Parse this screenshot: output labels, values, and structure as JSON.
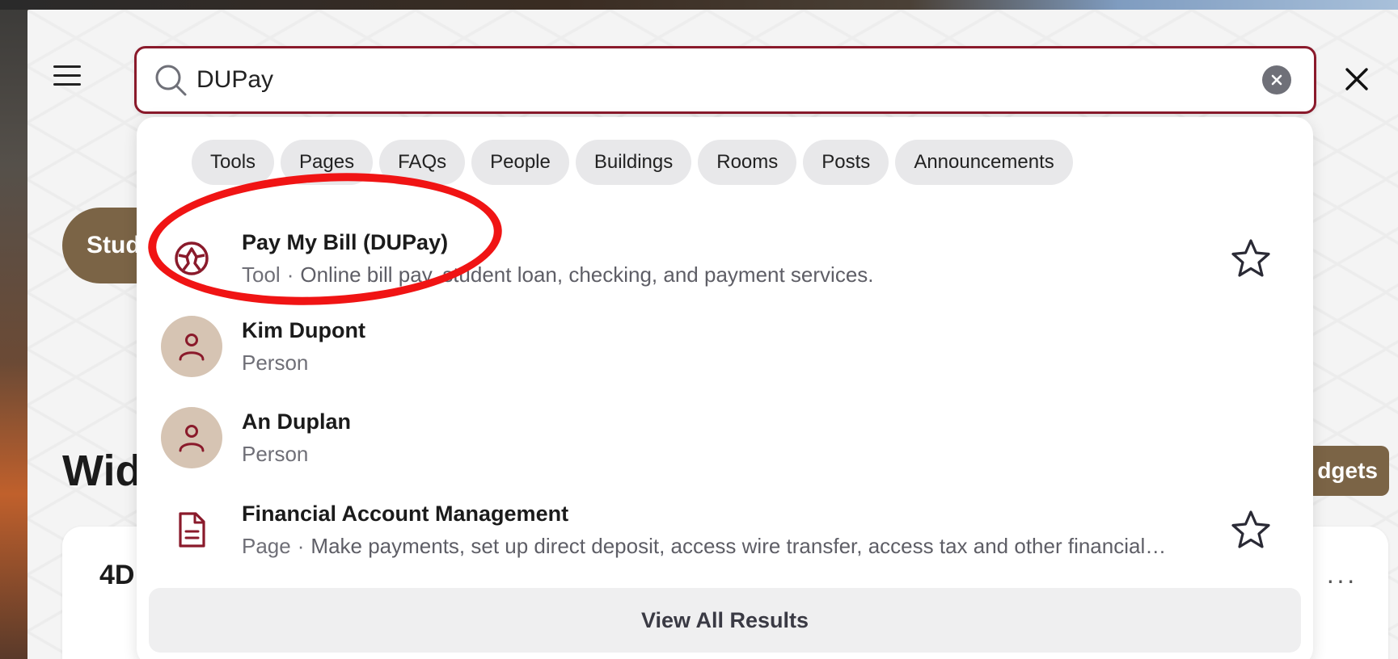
{
  "search": {
    "value": "DUPay",
    "placeholder": ""
  },
  "background_page": {
    "student_pill_label": "Stud",
    "widgets_title": "Wid",
    "widgets_button_label": "dgets",
    "card_title": "4D",
    "card_more": "···"
  },
  "filters": [
    {
      "label": "Tools"
    },
    {
      "label": "Pages"
    },
    {
      "label": "FAQs"
    },
    {
      "label": "People"
    },
    {
      "label": "Buildings"
    },
    {
      "label": "Rooms"
    },
    {
      "label": "Posts"
    },
    {
      "label": "Announcements"
    }
  ],
  "results": [
    {
      "title": "Pay My Bill (DUPay)",
      "type": "Tool",
      "description": "Online bill pay, student loan, checking, and payment services.",
      "icon": "tool-icon"
    },
    {
      "title": "Kim Dupont",
      "type": "Person",
      "description": "",
      "icon": "person-icon"
    },
    {
      "title": "An Duplan",
      "type": "Person",
      "description": "",
      "icon": "person-icon"
    },
    {
      "title": "Financial Account Management",
      "type": "Page",
      "description": "Make payments, set up direct deposit, access wire transfer, access tax and other financial…",
      "icon": "document-icon"
    }
  ],
  "view_all_label": "View All Results",
  "colors": {
    "accent": "#8a1a2b",
    "annotation": "#f01414",
    "brown": "#7b6446"
  }
}
